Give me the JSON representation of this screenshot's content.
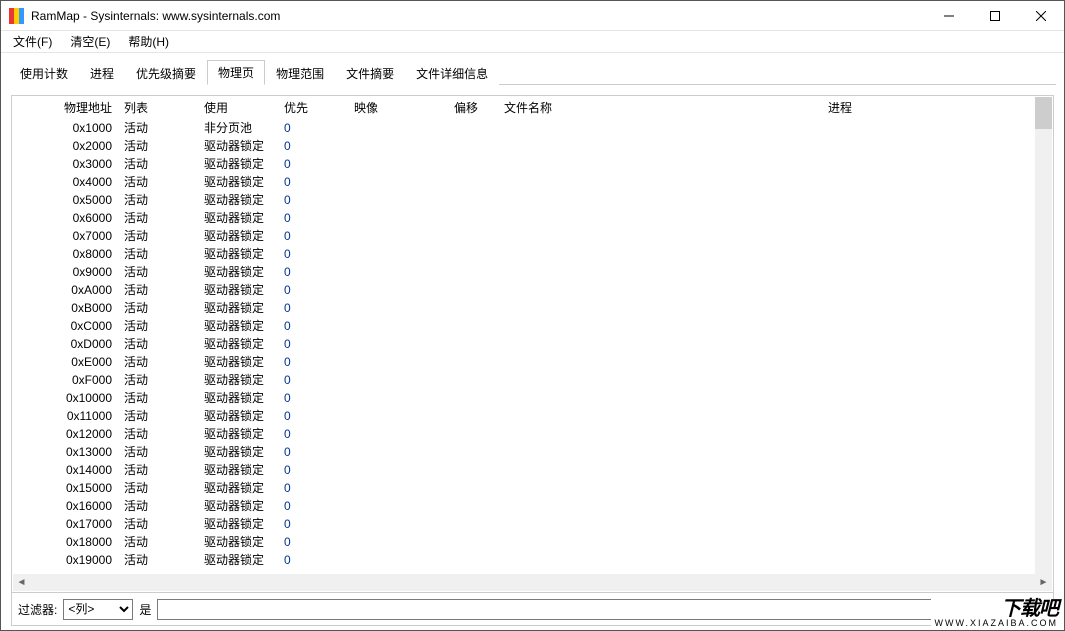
{
  "window": {
    "title": "RamMap - Sysinternals: www.sysinternals.com"
  },
  "menu": {
    "file": "文件(F)",
    "empty": "清空(E)",
    "help": "帮助(H)"
  },
  "tabs": [
    {
      "id": "use_counts",
      "label": "使用计数",
      "active": false
    },
    {
      "id": "processes",
      "label": "进程",
      "active": false
    },
    {
      "id": "priority",
      "label": "优先级摘要",
      "active": false
    },
    {
      "id": "phys_pages",
      "label": "物理页",
      "active": true
    },
    {
      "id": "phys_ranges",
      "label": "物理范围",
      "active": false
    },
    {
      "id": "file_summary",
      "label": "文件摘要",
      "active": false
    },
    {
      "id": "file_details",
      "label": "文件详细信息",
      "active": false
    }
  ],
  "columns": {
    "addr": "物理地址",
    "list": "列表",
    "use": "使用",
    "pri": "优先",
    "img": "映像",
    "off": "偏移",
    "file": "文件名称",
    "proc": "进程"
  },
  "rows": [
    {
      "addr": "0x1000",
      "list": "活动",
      "use": "非分页池",
      "pri": "0"
    },
    {
      "addr": "0x2000",
      "list": "活动",
      "use": "驱动器锁定",
      "pri": "0"
    },
    {
      "addr": "0x3000",
      "list": "活动",
      "use": "驱动器锁定",
      "pri": "0"
    },
    {
      "addr": "0x4000",
      "list": "活动",
      "use": "驱动器锁定",
      "pri": "0"
    },
    {
      "addr": "0x5000",
      "list": "活动",
      "use": "驱动器锁定",
      "pri": "0"
    },
    {
      "addr": "0x6000",
      "list": "活动",
      "use": "驱动器锁定",
      "pri": "0"
    },
    {
      "addr": "0x7000",
      "list": "活动",
      "use": "驱动器锁定",
      "pri": "0"
    },
    {
      "addr": "0x8000",
      "list": "活动",
      "use": "驱动器锁定",
      "pri": "0"
    },
    {
      "addr": "0x9000",
      "list": "活动",
      "use": "驱动器锁定",
      "pri": "0"
    },
    {
      "addr": "0xA000",
      "list": "活动",
      "use": "驱动器锁定",
      "pri": "0"
    },
    {
      "addr": "0xB000",
      "list": "活动",
      "use": "驱动器锁定",
      "pri": "0"
    },
    {
      "addr": "0xC000",
      "list": "活动",
      "use": "驱动器锁定",
      "pri": "0"
    },
    {
      "addr": "0xD000",
      "list": "活动",
      "use": "驱动器锁定",
      "pri": "0"
    },
    {
      "addr": "0xE000",
      "list": "活动",
      "use": "驱动器锁定",
      "pri": "0"
    },
    {
      "addr": "0xF000",
      "list": "活动",
      "use": "驱动器锁定",
      "pri": "0"
    },
    {
      "addr": "0x10000",
      "list": "活动",
      "use": "驱动器锁定",
      "pri": "0"
    },
    {
      "addr": "0x11000",
      "list": "活动",
      "use": "驱动器锁定",
      "pri": "0"
    },
    {
      "addr": "0x12000",
      "list": "活动",
      "use": "驱动器锁定",
      "pri": "0"
    },
    {
      "addr": "0x13000",
      "list": "活动",
      "use": "驱动器锁定",
      "pri": "0"
    },
    {
      "addr": "0x14000",
      "list": "活动",
      "use": "驱动器锁定",
      "pri": "0"
    },
    {
      "addr": "0x15000",
      "list": "活动",
      "use": "驱动器锁定",
      "pri": "0"
    },
    {
      "addr": "0x16000",
      "list": "活动",
      "use": "驱动器锁定",
      "pri": "0"
    },
    {
      "addr": "0x17000",
      "list": "活动",
      "use": "驱动器锁定",
      "pri": "0"
    },
    {
      "addr": "0x18000",
      "list": "活动",
      "use": "驱动器锁定",
      "pri": "0"
    },
    {
      "addr": "0x19000",
      "list": "活动",
      "use": "驱动器锁定",
      "pri": "0"
    }
  ],
  "filter": {
    "label": "过滤器:",
    "column_placeholder": "<列>",
    "is": "是"
  },
  "watermark": {
    "big": "下载吧",
    "sub": "WWW.XIAZAIBA.COM"
  }
}
